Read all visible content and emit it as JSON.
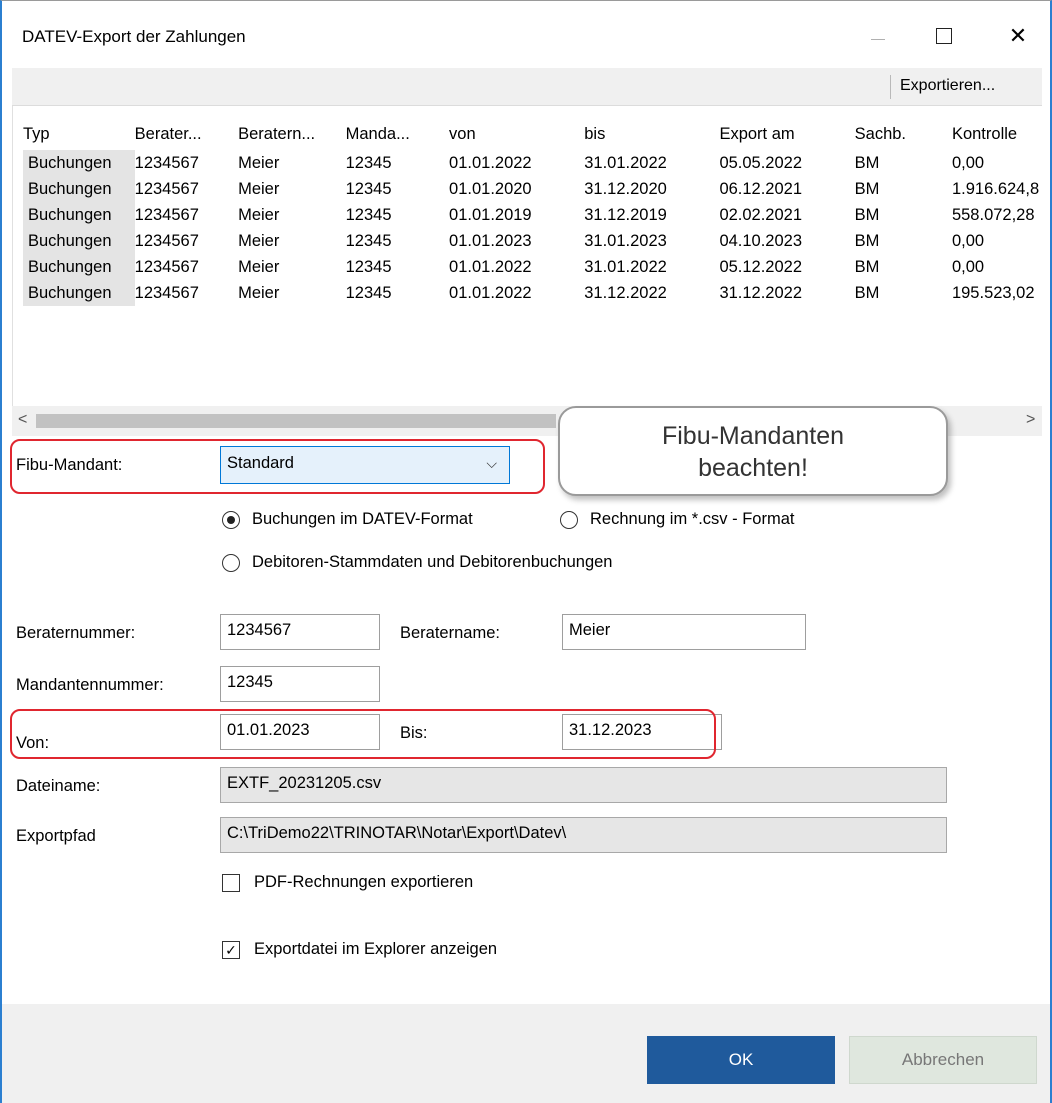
{
  "window": {
    "title": "DATEV-Export der Zahlungen",
    "minimize_icon": "minimize-icon",
    "maximize_icon": "maximize-icon",
    "close_glyph": "✕"
  },
  "toolbar": {
    "export_label": "Exportieren..."
  },
  "table": {
    "columns": [
      "Typ",
      "Berater...",
      "Beratern...",
      "Manda...",
      "von",
      "bis",
      "Export am",
      "Sachb.",
      "Kontrolle"
    ],
    "rows": [
      [
        "Buchungen",
        "1234567",
        "Meier",
        "12345",
        "01.01.2022",
        "31.01.2022",
        "05.05.2022",
        "BM",
        "0,00"
      ],
      [
        "Buchungen",
        "1234567",
        "Meier",
        "12345",
        "01.01.2020",
        "31.12.2020",
        "06.12.2021",
        "BM",
        "1.916.624,8"
      ],
      [
        "Buchungen",
        "1234567",
        "Meier",
        "12345",
        "01.01.2019",
        "31.12.2019",
        "02.02.2021",
        "BM",
        "558.072,28"
      ],
      [
        "Buchungen",
        "1234567",
        "Meier",
        "12345",
        "01.01.2023",
        "31.01.2023",
        "04.10.2023",
        "BM",
        "0,00"
      ],
      [
        "Buchungen",
        "1234567",
        "Meier",
        "12345",
        "01.01.2022",
        "31.01.2022",
        "05.12.2022",
        "BM",
        "0,00"
      ],
      [
        "Buchungen",
        "1234567",
        "Meier",
        "12345",
        "01.01.2022",
        "31.12.2022",
        "31.12.2022",
        "BM",
        "195.523,02"
      ]
    ]
  },
  "scroll": {
    "left_arrow": "<",
    "right_arrow": ">"
  },
  "form": {
    "fibu_label": "Fibu-Mandant:",
    "fibu_value": "Standard",
    "fibu_chevron": "⌵",
    "radio_datev": "Buchungen im DATEV-Format",
    "radio_csv": "Rechnung im *.csv - Format",
    "radio_debitoren": "Debitoren-Stammdaten und Debitorenbuchungen",
    "selected_radio": "datev",
    "beraternummer_label": "Beraternummer:",
    "beraternummer_value": "1234567",
    "beratername_label": "Beratername:",
    "beratername_value": "Meier",
    "mandantennummer_label": "Mandantennummer:",
    "mandantennummer_value": "12345",
    "von_label": "Von:",
    "von_value": "01.01.2023",
    "bis_label": "Bis:",
    "bis_value": "31.12.2023",
    "dateiname_label": "Dateiname:",
    "dateiname_value": "EXTF_20231205.csv",
    "exportpfad_label": "Exportpfad",
    "exportpfad_value": "C:\\TriDemo22\\TRINOTAR\\Notar\\Export\\Datev\\",
    "pdf_label": "PDF-Rechnungen exportieren",
    "pdf_checked": false,
    "explorer_label": "Exportdatei im Explorer anzeigen",
    "explorer_checked": true,
    "check_glyph": "✓"
  },
  "callout": {
    "line1": "Fibu-Mandanten",
    "line2": "beachten!"
  },
  "buttons": {
    "ok": "OK",
    "cancel": "Abbrechen"
  },
  "colors": {
    "highlight": "#e0262f",
    "ok_button": "#1f5a9c",
    "accent": "#0078d7"
  }
}
